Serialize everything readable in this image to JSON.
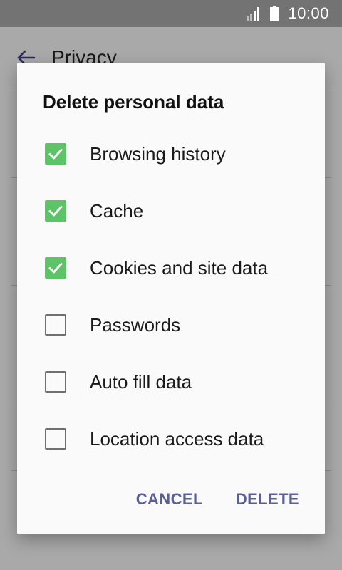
{
  "status_bar": {
    "time": "10:00"
  },
  "app_bar": {
    "title": "Privacy"
  },
  "dialog": {
    "title": "Delete personal data",
    "options": [
      {
        "label": "Browsing history",
        "checked": true
      },
      {
        "label": "Cache",
        "checked": true
      },
      {
        "label": "Cookies and site data",
        "checked": true
      },
      {
        "label": "Passwords",
        "checked": false
      },
      {
        "label": "Auto fill data",
        "checked": false
      },
      {
        "label": "Location access data",
        "checked": false
      }
    ],
    "cancel_label": "CANCEL",
    "delete_label": "DELETE"
  },
  "colors": {
    "accent": "#5b5f99",
    "checkbox_checked": "#5cc466",
    "status_bar": "#737373"
  }
}
